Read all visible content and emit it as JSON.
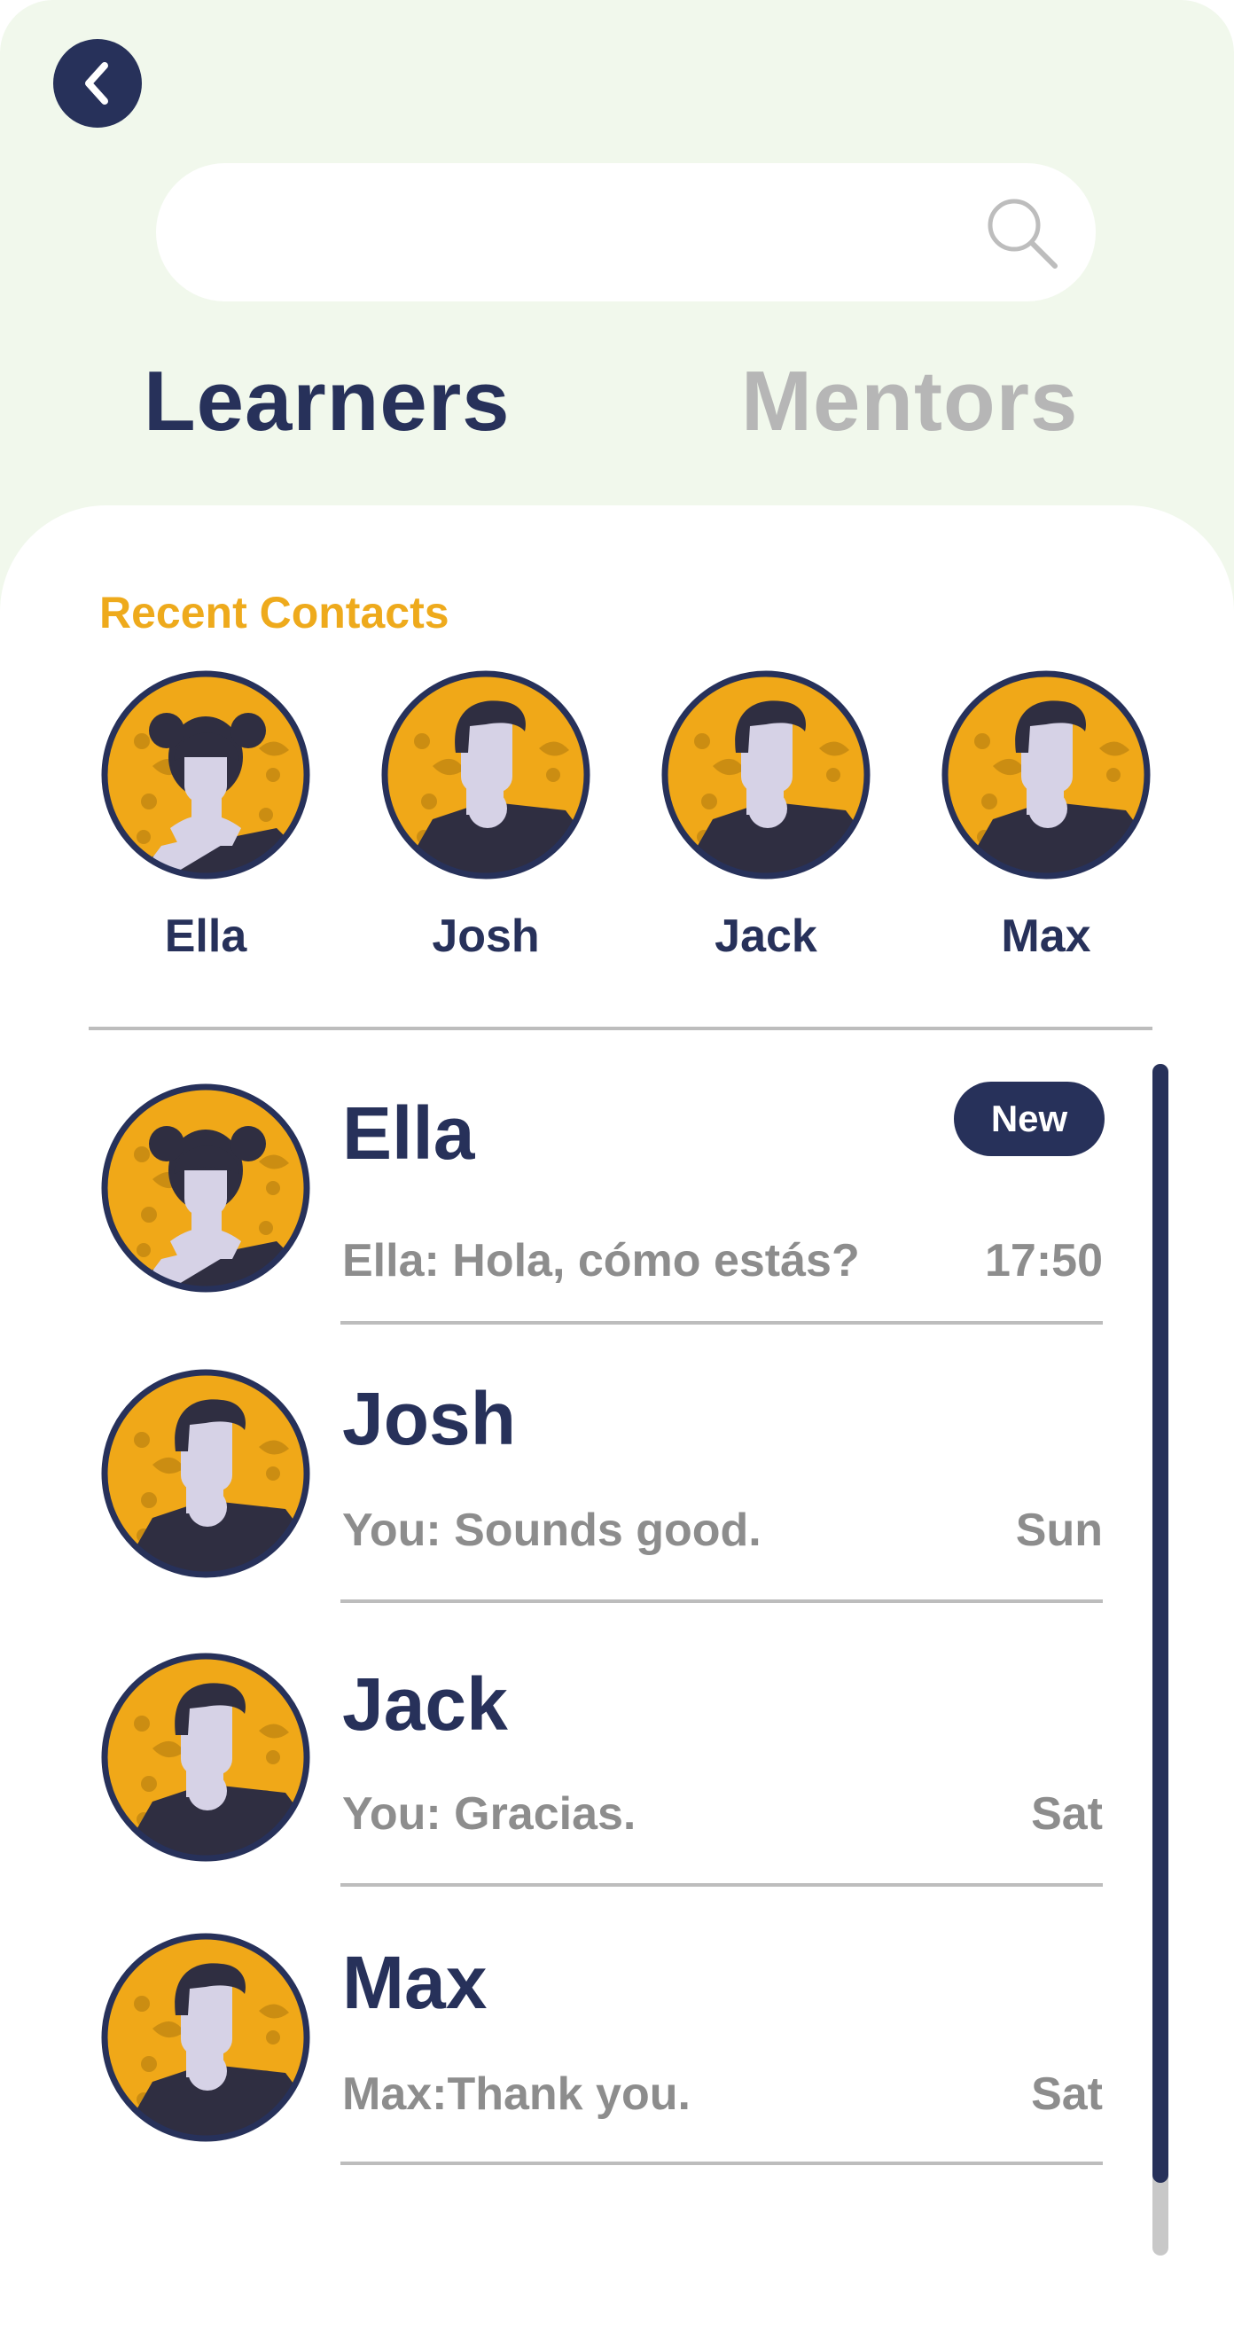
{
  "header": {
    "back_icon": "chevron-left-icon",
    "search": {
      "value": "",
      "placeholder": "",
      "icon": "search-icon"
    }
  },
  "tabs": [
    {
      "label": "Learners",
      "active": true
    },
    {
      "label": "Mentors",
      "active": false
    }
  ],
  "recent": {
    "title": "Recent Contacts",
    "contacts": [
      {
        "name": "Ella",
        "avatar": "girl-avatar"
      },
      {
        "name": "Josh",
        "avatar": "boy-avatar"
      },
      {
        "name": "Jack",
        "avatar": "boy-avatar"
      },
      {
        "name": "Max",
        "avatar": "boy-avatar"
      }
    ]
  },
  "conversations": [
    {
      "name": "Ella",
      "preview": "Ella: Hola, cómo estás?",
      "time": "17:50",
      "badge": "New",
      "avatar": "girl-avatar"
    },
    {
      "name": "Josh",
      "preview": "You: Sounds good.",
      "time": "Sun",
      "avatar": "boy-avatar"
    },
    {
      "name": "Jack",
      "preview": "You: Gracias.",
      "time": "Sat",
      "avatar": "boy-avatar"
    },
    {
      "name": "Max",
      "preview": "Max:Thank you.",
      "time": "Sat",
      "avatar": "boy-avatar"
    }
  ],
  "colors": {
    "navy": "#27315a",
    "accent_orange": "#eeaa1c",
    "avatar_bg": "#f0a818",
    "header_bg": "#f1f8ec",
    "muted_text": "#8d8d8d",
    "inactive_tab": "#b6b6b6"
  }
}
